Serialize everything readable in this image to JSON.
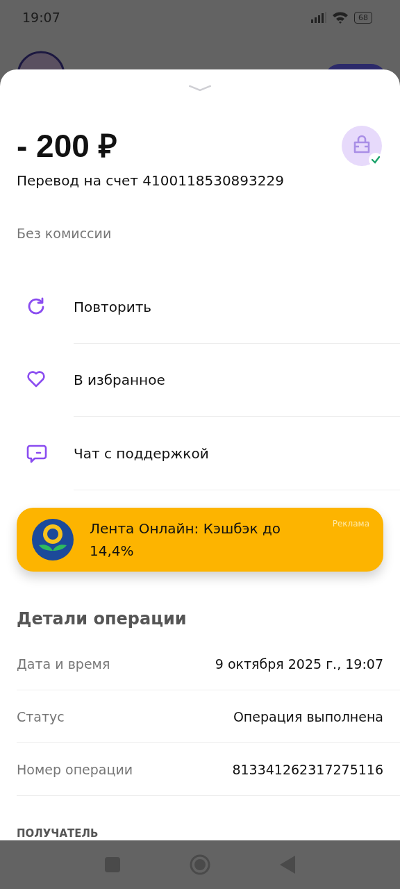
{
  "status_bar": {
    "time": "19:07",
    "battery": "68"
  },
  "sheet": {
    "amount": "- 200 ₽",
    "description": "Перевод на счет 4100118530893229",
    "fee_note": "Без комиссии",
    "actions": [
      {
        "kind": "repeat",
        "label": "Повторить"
      },
      {
        "kind": "favorite",
        "label": "В избранное"
      },
      {
        "kind": "chat",
        "label": "Чат с поддержкой"
      }
    ],
    "ad": {
      "text": "Лента Онлайн: Кэшбэк до 14,4%",
      "tag": "Реклама"
    },
    "details": {
      "title": "Детали операции",
      "rows": [
        {
          "label": "Дата и время",
          "value": "9 октября 2025 г., 19:07"
        },
        {
          "label": "Статус",
          "value": "Операция выполнена"
        },
        {
          "label": "Номер операции",
          "value": "813341262317275116"
        }
      ]
    },
    "section_label": "ПОЛУЧАТЕЛЬ"
  }
}
